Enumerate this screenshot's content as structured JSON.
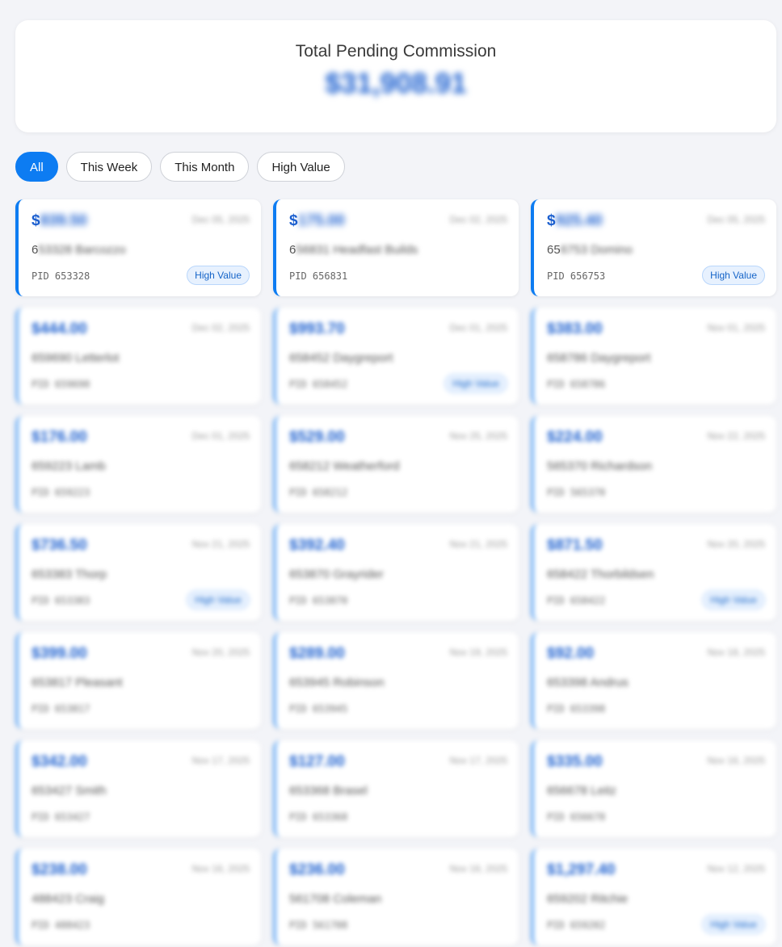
{
  "summary": {
    "title": "Total Pending Commission",
    "value": "$31,908.91"
  },
  "filters": [
    {
      "label": "All",
      "active": true
    },
    {
      "label": "This Week",
      "active": false
    },
    {
      "label": "This Month",
      "active": false
    },
    {
      "label": "High Value",
      "active": false
    }
  ],
  "badge_label": "High Value",
  "cards": [
    {
      "amount_sym": "$",
      "amount_rest": "839.50",
      "date": "Dec 05, 2025",
      "name_prefix": "6",
      "name_rest": "53328 Barcozzo",
      "pid": "PID 653328",
      "high_value": true
    },
    {
      "amount_sym": "$",
      "amount_rest": "175.00",
      "date": "Dec 02, 2025",
      "name_prefix": "6",
      "name_rest": "56831 Headfast Builds",
      "pid": "PID 656831",
      "high_value": false
    },
    {
      "amount_sym": "$",
      "amount_rest": "925.40",
      "date": "Dec 05, 2025",
      "name_prefix": "65",
      "name_rest": "6753 Domino",
      "pid": "PID 656753",
      "high_value": true
    },
    {
      "amount_sym": "$",
      "amount_rest": "444.00",
      "date": "Dec 02, 2025",
      "name_prefix": "",
      "name_rest": "659690 Letterlot",
      "pid": "PID 659690",
      "high_value": false
    },
    {
      "amount_sym": "$",
      "amount_rest": "993.70",
      "date": "Dec 01, 2025",
      "name_prefix": "",
      "name_rest": "658452 Daygreport",
      "pid": "PID 658452",
      "high_value": true
    },
    {
      "amount_sym": "$",
      "amount_rest": "383.00",
      "date": "Nov 01, 2025",
      "name_prefix": "",
      "name_rest": "658786 Daygreport",
      "pid": "PID 658786",
      "high_value": false
    },
    {
      "amount_sym": "$",
      "amount_rest": "176.00",
      "date": "Dec 01, 2025",
      "name_prefix": "",
      "name_rest": "659223 Lamb",
      "pid": "PID 659223",
      "high_value": false
    },
    {
      "amount_sym": "$",
      "amount_rest": "529.00",
      "date": "Nov 25, 2025",
      "name_prefix": "",
      "name_rest": "658212 Weatherford",
      "pid": "PID 658212",
      "high_value": false
    },
    {
      "amount_sym": "$",
      "amount_rest": "224.00",
      "date": "Nov 22, 2025",
      "name_prefix": "",
      "name_rest": "565370 Richardson",
      "pid": "PID 565370",
      "high_value": false
    },
    {
      "amount_sym": "$",
      "amount_rest": "736.50",
      "date": "Nov 21, 2025",
      "name_prefix": "",
      "name_rest": "653383 Thorp",
      "pid": "PID 653383",
      "high_value": true
    },
    {
      "amount_sym": "$",
      "amount_rest": "392.40",
      "date": "Nov 21, 2025",
      "name_prefix": "",
      "name_rest": "653870 Grayrider",
      "pid": "PID 653870",
      "high_value": false
    },
    {
      "amount_sym": "$",
      "amount_rest": "871.50",
      "date": "Nov 20, 2025",
      "name_prefix": "",
      "name_rest": "658422 Thorbildsen",
      "pid": "PID 658422",
      "high_value": true
    },
    {
      "amount_sym": "$",
      "amount_rest": "399.00",
      "date": "Nov 20, 2025",
      "name_prefix": "",
      "name_rest": "653817 Pleasant",
      "pid": "PID 653817",
      "high_value": false
    },
    {
      "amount_sym": "$",
      "amount_rest": "289.00",
      "date": "Nov 19, 2025",
      "name_prefix": "",
      "name_rest": "653945 Robinson",
      "pid": "PID 653945",
      "high_value": false
    },
    {
      "amount_sym": "$",
      "amount_rest": "92.00",
      "date": "Nov 18, 2025",
      "name_prefix": "",
      "name_rest": "653398 Andrus",
      "pid": "PID 653398",
      "high_value": false
    },
    {
      "amount_sym": "$",
      "amount_rest": "342.00",
      "date": "Nov 17, 2025",
      "name_prefix": "",
      "name_rest": "653427 Smith",
      "pid": "PID 653427",
      "high_value": false
    },
    {
      "amount_sym": "$",
      "amount_rest": "127.00",
      "date": "Nov 17, 2025",
      "name_prefix": "",
      "name_rest": "653368 Brasel",
      "pid": "PID 653368",
      "high_value": false
    },
    {
      "amount_sym": "$",
      "amount_rest": "335.00",
      "date": "Nov 16, 2025",
      "name_prefix": "",
      "name_rest": "656678 Leitz",
      "pid": "PID 656678",
      "high_value": false
    },
    {
      "amount_sym": "$",
      "amount_rest": "238.00",
      "date": "Nov 16, 2025",
      "name_prefix": "",
      "name_rest": "488423 Craig",
      "pid": "PID 488423",
      "high_value": false
    },
    {
      "amount_sym": "$",
      "amount_rest": "236.00",
      "date": "Nov 16, 2025",
      "name_prefix": "",
      "name_rest": "561708 Coleman",
      "pid": "PID 561708",
      "high_value": false
    },
    {
      "amount_sym": "$",
      "amount_rest": "1,297.40",
      "date": "Nov 12, 2025",
      "name_prefix": "",
      "name_rest": "659202 Ritchie",
      "pid": "PID 659202",
      "high_value": true
    }
  ]
}
